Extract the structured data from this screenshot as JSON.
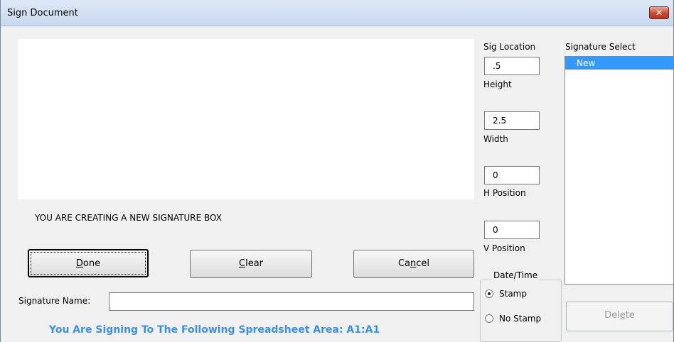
{
  "window": {
    "title": "Sign Document",
    "close_glyph": "✕"
  },
  "status_message": "YOU ARE CREATING A NEW SIGNATURE BOX",
  "fields": {
    "sig_location_label": "Sig Location",
    "sig_location_value": ".5",
    "height_label": "Height",
    "height_value": "2.5",
    "width_label": "Width",
    "width_value": "0",
    "h_position_label": "H Position",
    "h_position_value": "0",
    "v_position_label": "V Position"
  },
  "signature_select": {
    "label": "Signature Select",
    "items": [
      "New"
    ],
    "selected": "New"
  },
  "buttons": {
    "done": {
      "pre": "",
      "accel": "D",
      "post": "one"
    },
    "clear": {
      "pre": "",
      "accel": "C",
      "post": "lear"
    },
    "cancel": {
      "pre": "Ca",
      "accel": "n",
      "post": "cel"
    },
    "delete": {
      "pre": "Del",
      "accel": "e",
      "post": "te"
    }
  },
  "signature_name": {
    "label": "Signature Name:",
    "value": ""
  },
  "date_time": {
    "legend": "Date/Time",
    "options": [
      "Stamp",
      "No Stamp"
    ],
    "selected": "Stamp"
  },
  "footer": "You Are Signing To The Following Spreadsheet Area: A1:A1"
}
